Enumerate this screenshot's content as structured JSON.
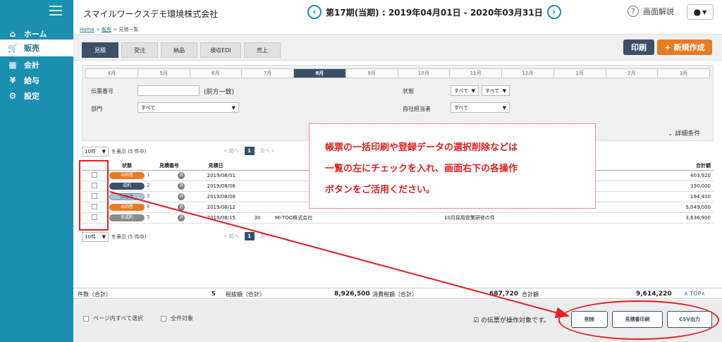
{
  "app": {
    "company": "スマイルワークスデモ環境株式会社",
    "period": "第17期(当期) : 2019年04月01日 - 2020年03月31日",
    "help_label": "画面解説"
  },
  "sidebar": {
    "items": [
      {
        "label": "ホーム",
        "icon": "home-icon",
        "glyph": "⌂"
      },
      {
        "label": "販売",
        "icon": "cart-icon",
        "glyph": "🛒"
      },
      {
        "label": "会計",
        "icon": "calculator-icon",
        "glyph": "▦"
      },
      {
        "label": "給与",
        "icon": "money-bag-icon",
        "glyph": "¥"
      },
      {
        "label": "設定",
        "icon": "gear-icon",
        "glyph": "⚙"
      }
    ]
  },
  "breadcrumb": {
    "home": "Home",
    "sales": "販売",
    "current": "見積一覧",
    "sep": ">"
  },
  "tabs": [
    "見積",
    "受注",
    "納品",
    "検収EDI",
    "売上"
  ],
  "actions": {
    "print": "印刷",
    "new": "+ 新規作成"
  },
  "months": [
    "4月",
    "5月",
    "6月",
    "7月",
    "8月",
    "9月",
    "10月",
    "11月",
    "12月",
    "1月",
    "2月",
    "3月"
  ],
  "filter": {
    "slip_label": "伝票番号",
    "slip_hint": "(前方一致)",
    "dept_label": "部門",
    "dept_value": "すべて",
    "status_label": "状態",
    "status_value1": "すべて",
    "status_value2": "すべて",
    "staff_label": "自社担当者",
    "staff_value": "すべて",
    "detail_toggle": "詳細条件"
  },
  "pager": {
    "per_page": "10件",
    "note": "を表示 (5 件中)",
    "prev": "« 前へ",
    "page": "1",
    "next": "次へ »"
  },
  "table": {
    "headers": {
      "status": "状態",
      "number": "見積番号",
      "date": "見積日",
      "total": "合計額"
    },
    "rows": [
      {
        "status": "未回答",
        "tone": "st-orange",
        "number": "1",
        "tax": "消",
        "date": "2019/08/01",
        "code": "",
        "customer": "",
        "subject": "",
        "total": "403,920"
      },
      {
        "status": "成約",
        "tone": "st-navy",
        "number": "2",
        "tax": "消",
        "date": "2019/08/06",
        "code": "",
        "customer": "",
        "subject": "",
        "total": "330,000"
      },
      {
        "status": "回答済",
        "tone": "st-light",
        "number": "3",
        "tax": "消",
        "date": "2019/08/08",
        "code": "",
        "customer": "",
        "subject": "",
        "total": "194,400"
      },
      {
        "status": "未回答",
        "tone": "st-orange",
        "number": "4",
        "tax": "消",
        "date": "2019/08/12",
        "code": "",
        "customer": "",
        "subject": "",
        "total": "5,049,000"
      },
      {
        "status": "否成約",
        "tone": "st-gray",
        "number": "5",
        "tax": "消",
        "date": "2019/08/15",
        "code": "30",
        "customer": "MI-TOO株式会社",
        "subject": "10月採用営業研修の件",
        "total": "3,636,900"
      }
    ]
  },
  "totals": {
    "count_label": "件数（合計）",
    "count": "5",
    "pretax_label": "税抜額（合計）",
    "pretax": "8,926,500",
    "tax_label": "消費税額（合計）",
    "tax": "687,720",
    "sum_label": "合計額",
    "sum": "9,614,220",
    "top": "∧ TOP∧"
  },
  "bottom": {
    "select_page": "ページ内すべて選択",
    "select_all": "全件対象",
    "note": "の伝票が操作対象です。",
    "delete": "削除",
    "estimate_print": "見積書印刷",
    "csv": "CSV出力"
  },
  "callout": {
    "line1": "帳票の一括印刷や登録データの選択削除などは",
    "line2": "一覧の左にチェックを入れ、画面右下の各操作",
    "line3": "ボタンをご活用ください。"
  },
  "colors": {
    "sidebar": "#1b8fb0",
    "navy": "#3b5068",
    "orange": "#e77b22",
    "annotation": "#e02020"
  }
}
